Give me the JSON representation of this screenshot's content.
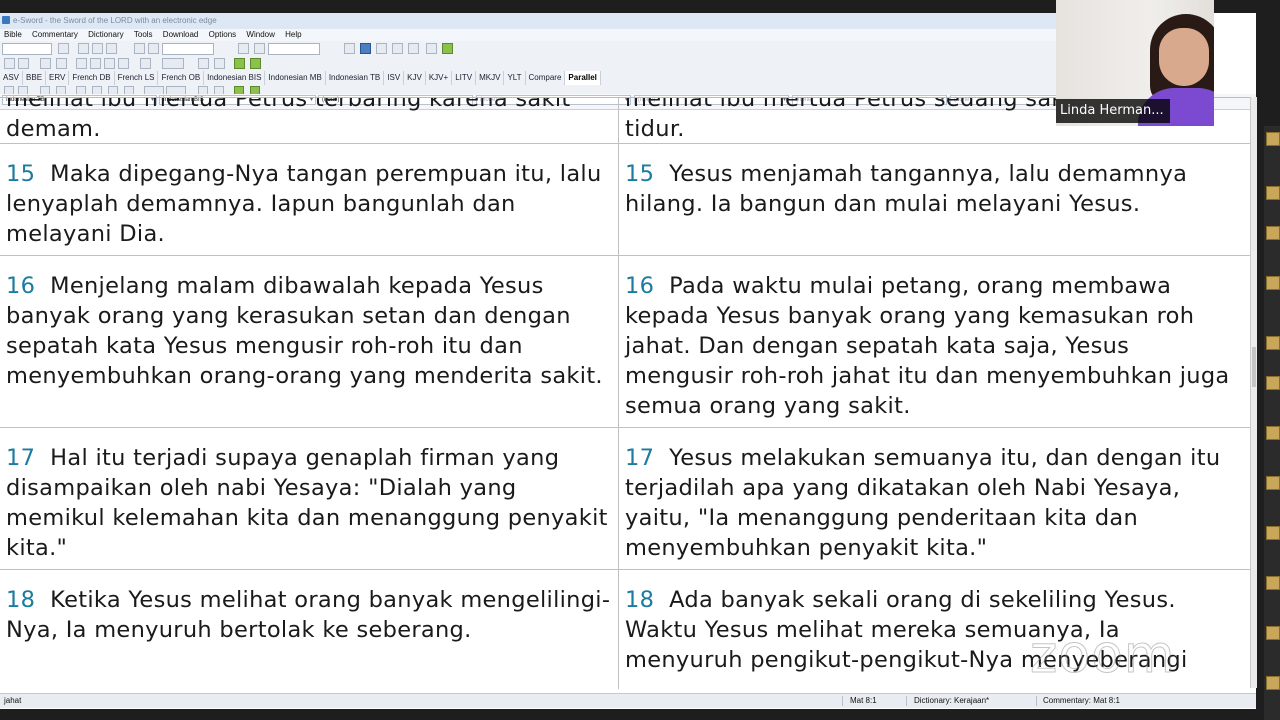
{
  "window": {
    "title": "e-Sword - the Sword of the LORD with an electronic edge"
  },
  "menu": [
    "Bible",
    "Commentary",
    "Dictionary",
    "Tools",
    "Download",
    "Options",
    "Window",
    "Help"
  ],
  "bible_tabs": [
    {
      "label": "ASV"
    },
    {
      "label": "BBE"
    },
    {
      "label": "ERV"
    },
    {
      "label": "French DB"
    },
    {
      "label": "French LS"
    },
    {
      "label": "French OB"
    },
    {
      "label": "Indonesian BIS"
    },
    {
      "label": "Indonesian MB"
    },
    {
      "label": "Indonesian TB"
    },
    {
      "label": "ISV"
    },
    {
      "label": "KJV"
    },
    {
      "label": "KJV+"
    },
    {
      "label": "LITV"
    },
    {
      "label": "MKJV"
    },
    {
      "label": "YLT"
    },
    {
      "label": "Compare"
    },
    {
      "label": "Parallel",
      "active": true
    }
  ],
  "parallel_selectors": [
    {
      "value": "Indonesian TB"
    },
    {
      "value": "Indonesian BIS"
    },
    {
      "value": "(none)"
    },
    {
      "value": "(none)"
    },
    {
      "value": "(none)"
    },
    {
      "value": "(none)"
    },
    {
      "value": "(none)"
    }
  ],
  "columns": [
    {
      "verses": [
        {
          "num": "",
          "text": "melihat ibu mertua Petrus terbaring karena sakit demam."
        },
        {
          "num": "15",
          "text": "Maka dipegang-Nya tangan perempuan itu, lalu lenyaplah demamnya. Iapun bangunlah dan melayani Dia."
        },
        {
          "num": "16",
          "text": "Menjelang malam dibawalah kepada Yesus banyak orang yang kerasukan setan dan dengan sepatah kata Yesus mengusir roh-roh itu dan menyembuhkan orang-orang yang menderita sakit."
        },
        {
          "num": "17",
          "text": "Hal itu terjadi supaya genaplah firman yang disampaikan oleh nabi Yesaya: \"Dialah yang memikul kelemahan kita dan menanggung penyakit kita.\""
        },
        {
          "num": "18",
          "text": "Ketika Yesus melihat orang banyak mengelilingi-Nya, Ia menyuruh bertolak ke seberang."
        }
      ]
    },
    {
      "verses": [
        {
          "num": "",
          "text": "melihat ibu mertua Petrus sedang sakit di tempat tidur."
        },
        {
          "num": "15",
          "text": "Yesus menjamah tangannya, lalu demamnya hilang. Ia bangun dan mulai melayani Yesus."
        },
        {
          "num": "16",
          "text": "Pada waktu mulai petang, orang membawa kepada Yesus banyak orang yang kemasukan roh jahat. Dan dengan sepatah kata saja, Yesus mengusir roh-roh jahat itu dan menyembuhkan juga semua orang yang sakit."
        },
        {
          "num": "17",
          "text": "Yesus melakukan semuanya itu, dan dengan itu terjadilah apa yang dikatakan oleh Nabi Yesaya, yaitu, \"Ia menanggung penderitaan kita dan menyembuhkan penyakit kita.\""
        },
        {
          "num": "18",
          "text": "Ada banyak sekali orang di sekeliling Yesus. Waktu Yesus melihat mereka semuanya, Ia menyuruh pengikut-pengikut-Nya menyeberangi"
        }
      ]
    }
  ],
  "status": {
    "left": "jahat",
    "reference": "Mat 8:1",
    "dictionary": "Dictionary: Kerajaan*",
    "commentary": "Commentary: Mat 8:1"
  },
  "webcam": {
    "name": "Linda Herman..."
  },
  "watermark": "zoom",
  "colors": {
    "verse_number": "#1c7ba0",
    "active_tab": "#ffffff",
    "name_overlay": "#000000"
  }
}
